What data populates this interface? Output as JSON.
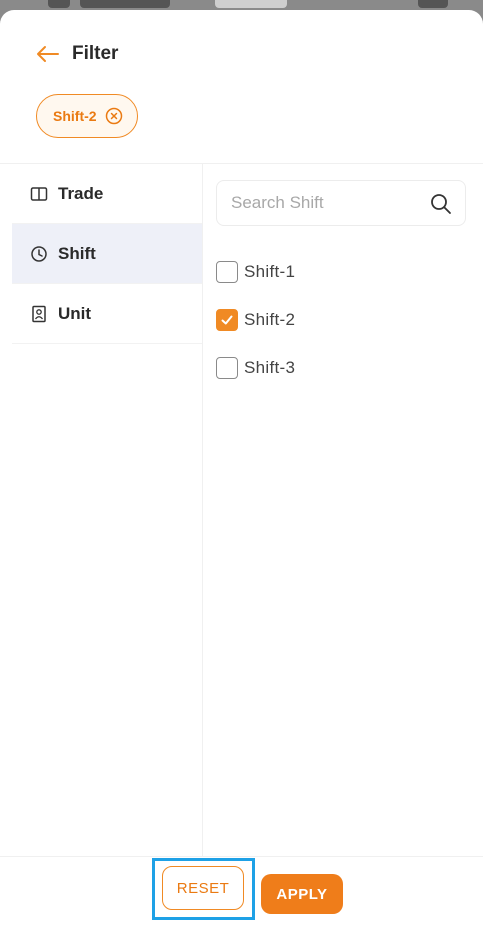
{
  "header": {
    "title": "Filter",
    "back_icon": "arrow-left-icon"
  },
  "applied_filters": [
    {
      "label": "Shift-2",
      "remove_icon": "close-circle-icon"
    }
  ],
  "sidebar": {
    "items": [
      {
        "label": "Trade",
        "icon": "book-open-icon",
        "active": false
      },
      {
        "label": "Shift",
        "icon": "clock-icon",
        "active": true
      },
      {
        "label": "Unit",
        "icon": "building-icon",
        "active": false
      }
    ]
  },
  "search": {
    "placeholder": "Search Shift",
    "value": ""
  },
  "options": [
    {
      "label": "Shift-1",
      "checked": false
    },
    {
      "label": "Shift-2",
      "checked": true
    },
    {
      "label": "Shift-3",
      "checked": false
    }
  ],
  "footer": {
    "reset_label": "RESET",
    "apply_label": "APPLY"
  },
  "colors": {
    "accent": "#EF7D1A",
    "highlight": "#1EA1E6",
    "active_tab_bg": "#EEF0F8"
  }
}
